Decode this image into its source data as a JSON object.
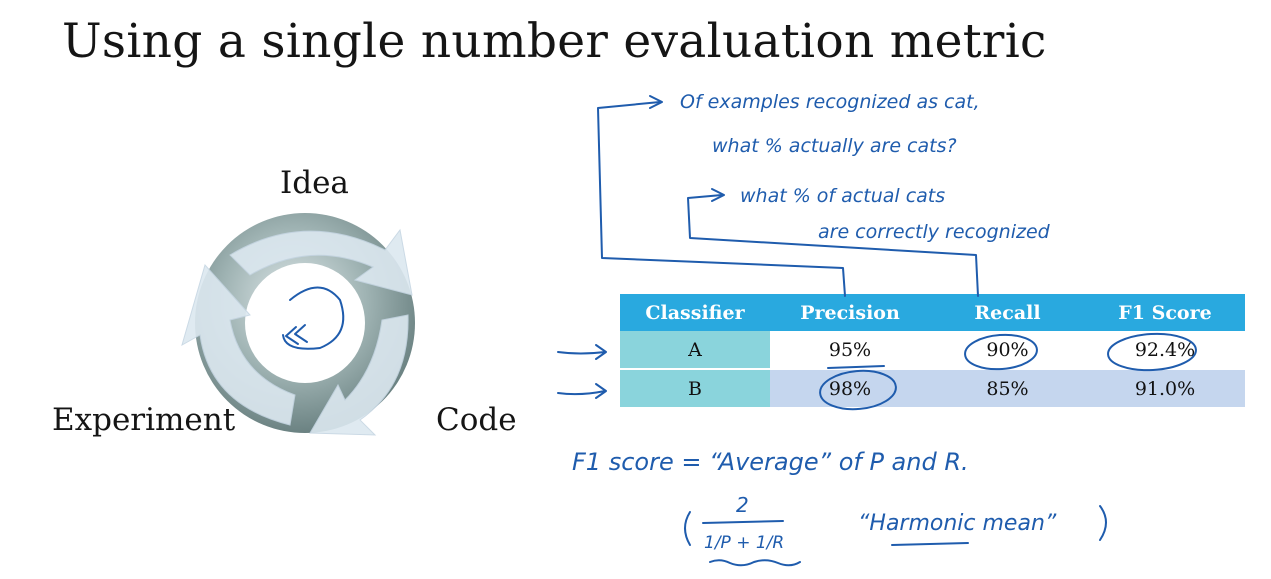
{
  "slide": {
    "title": "Using a single number evaluation metric"
  },
  "cycle": {
    "idea_label": "Idea",
    "code_label": "Code",
    "experiment_label": "Experiment"
  },
  "table": {
    "headers": [
      "Classifier",
      "Precision",
      "Recall",
      "F1 Score"
    ],
    "rows": [
      {
        "classifier": "A",
        "precision": "95%",
        "recall": "90%",
        "f1": "92.4%"
      },
      {
        "classifier": "B",
        "precision": "98%",
        "recall": "85%",
        "f1": "91.0%"
      }
    ]
  },
  "annotations": {
    "precision_note_line1": "Of examples recognized as cat,",
    "precision_note_line2": "what % actually are cats?",
    "recall_note_line1": "what % of actual cats",
    "recall_note_line2": "are correctly recognized",
    "f1_definition": "F1 score = “Average” of P and R.",
    "harmonic_mean": "“Harmonic mean”"
  },
  "colors": {
    "header_blue": "#29a9df",
    "classifier_teal": "#8ad4dc",
    "row_b_blue": "#c5d6ee",
    "ink_blue": "#1f5cad"
  }
}
